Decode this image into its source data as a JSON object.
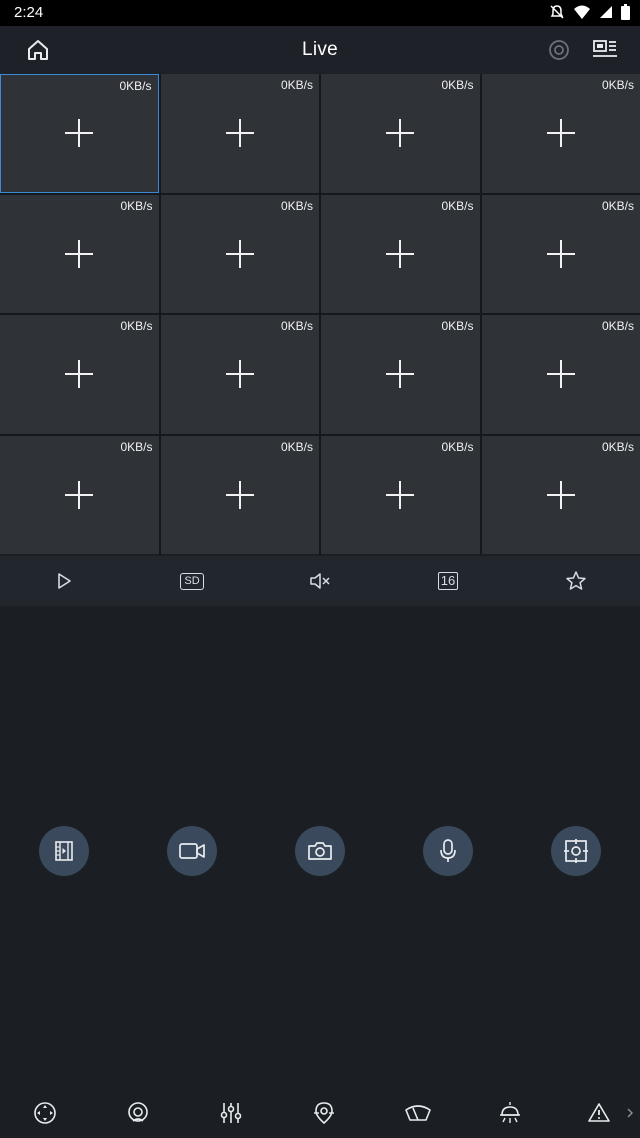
{
  "status": {
    "time": "2:24"
  },
  "header": {
    "title": "Live"
  },
  "grid": {
    "cells": [
      {
        "rate": "0KB/s",
        "selected": true
      },
      {
        "rate": "0KB/s"
      },
      {
        "rate": "0KB/s"
      },
      {
        "rate": "0KB/s"
      },
      {
        "rate": "0KB/s"
      },
      {
        "rate": "0KB/s"
      },
      {
        "rate": "0KB/s"
      },
      {
        "rate": "0KB/s"
      },
      {
        "rate": "0KB/s"
      },
      {
        "rate": "0KB/s"
      },
      {
        "rate": "0KB/s"
      },
      {
        "rate": "0KB/s"
      },
      {
        "rate": "0KB/s"
      },
      {
        "rate": "0KB/s"
      },
      {
        "rate": "0KB/s"
      },
      {
        "rate": "0KB/s"
      }
    ]
  },
  "toolbar": {
    "sd_label": "SD",
    "split_count": "16"
  },
  "colors": {
    "accent": "#3a8ad6",
    "action_bg": "#3a4a5c",
    "background": "#1b1e23"
  },
  "icons": {
    "header": [
      "home-icon",
      "record-icon",
      "multi-screen-icon"
    ],
    "toolbar": [
      "play-icon",
      "sd-icon",
      "mute-icon",
      "split-16-icon",
      "favorite-star-icon"
    ],
    "actions": [
      "video-clip-icon",
      "record-video-icon",
      "snapshot-camera-icon",
      "microphone-icon",
      "screenshot-target-icon"
    ],
    "ptz": [
      "ptz-joystick-icon",
      "eye-camera-icon",
      "sliders-icon",
      "location-pin-icon",
      "wiper-icon",
      "light-icon",
      "alarm-warning-icon",
      "chevron-right-icon"
    ]
  }
}
